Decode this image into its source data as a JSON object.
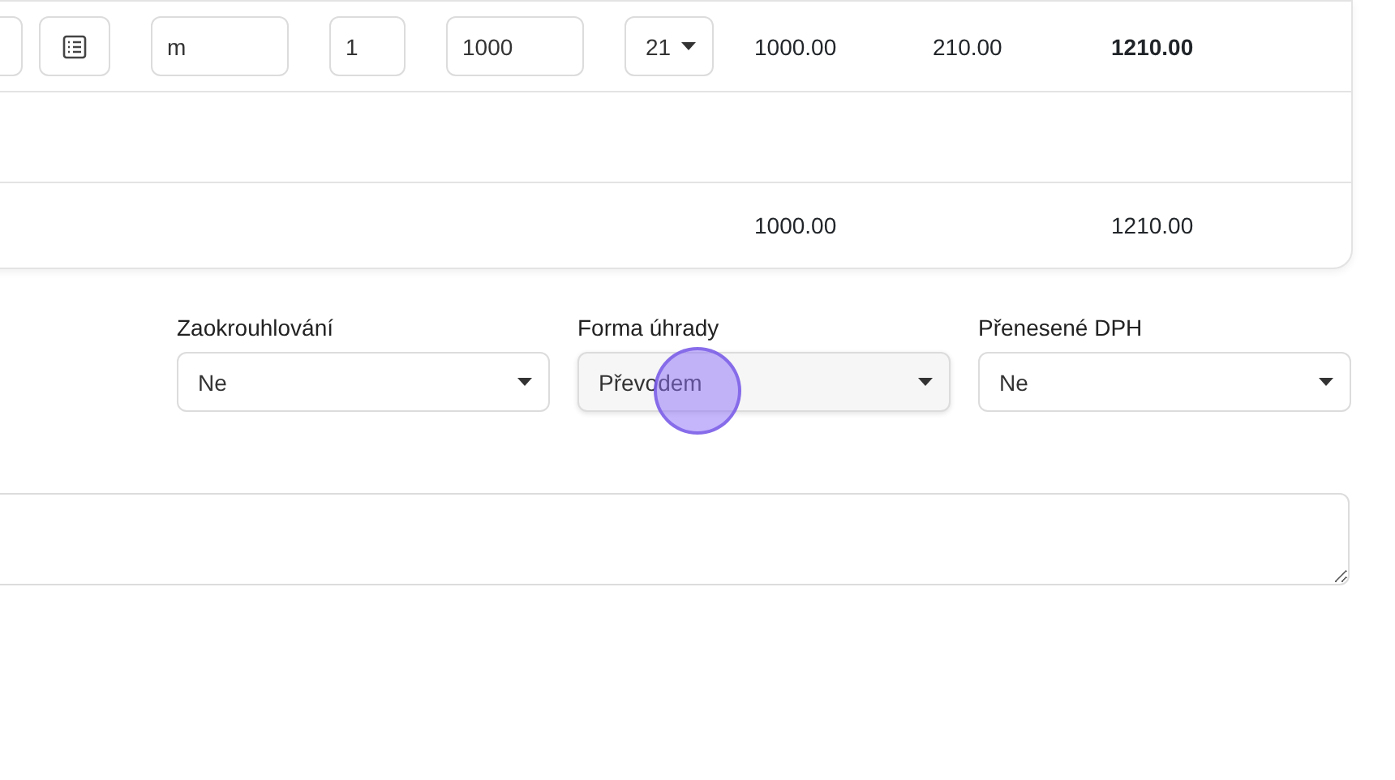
{
  "item_row": {
    "unit": "m",
    "quantity": "1",
    "unit_price": "1000",
    "vat_rate": "21",
    "subtotal": "1000.00",
    "vat": "210.00",
    "total": "1210.00"
  },
  "totals_row": {
    "subtotal": "1000.00",
    "total": "1210.00"
  },
  "fields": [
    {
      "label": "Zaokrouhlování",
      "value": "Ne",
      "focused": false
    },
    {
      "label": "Forma úhrady",
      "value": "Převodem",
      "focused": true
    },
    {
      "label": "Přenesené DPH",
      "value": "Ne",
      "focused": false
    }
  ]
}
